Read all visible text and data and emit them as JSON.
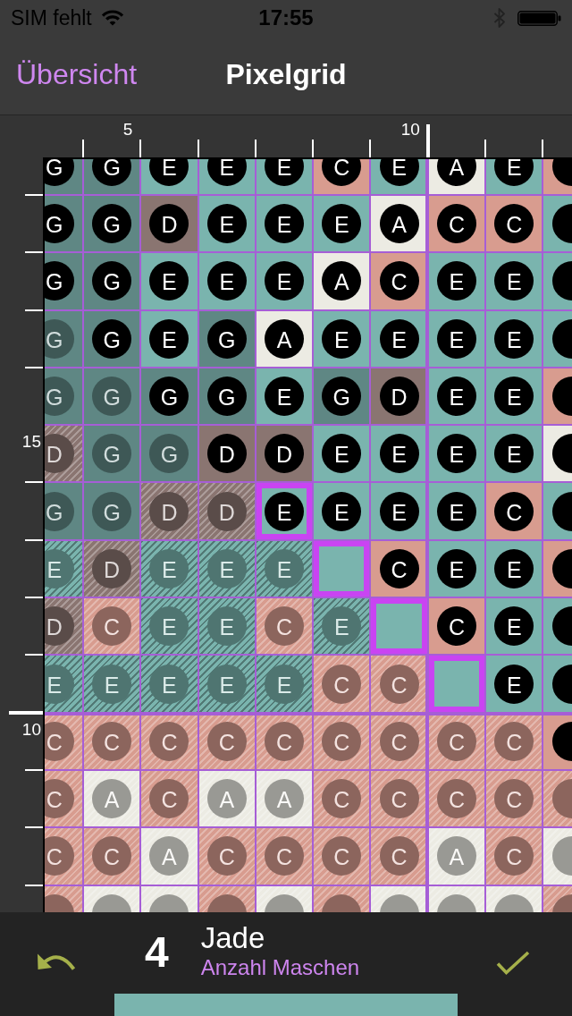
{
  "status_bar": {
    "carrier": "SIM fehlt",
    "time": "17:55"
  },
  "nav_bar": {
    "back": "Übersicht",
    "title": "Pixelgrid"
  },
  "grid": {
    "columns": [
      {
        "major": false
      },
      {
        "major": false,
        "label": "5"
      },
      {
        "major": false
      },
      {
        "major": false
      },
      {
        "major": false
      },
      {
        "major": false
      },
      {
        "major": true,
        "label": "10"
      },
      {
        "major": false
      },
      {
        "major": false
      },
      {
        "major": false
      }
    ],
    "rows": [
      {
        "major": false,
        "cells": [
          {
            "letter": "G",
            "color": "#5f8784",
            "kind": "stitch",
            "selected": false
          },
          {
            "letter": "G",
            "color": "#5f8784",
            "kind": "stitch",
            "selected": false
          },
          {
            "letter": "E",
            "color": "#7ab4ae",
            "kind": "stitch",
            "selected": false
          },
          {
            "letter": "E",
            "color": "#7ab4ae",
            "kind": "stitch",
            "selected": false
          },
          {
            "letter": "E",
            "color": "#7ab4ae",
            "kind": "stitch",
            "selected": false
          },
          {
            "letter": "C",
            "color": "#d89c8f",
            "kind": "stitch",
            "selected": false
          },
          {
            "letter": "E",
            "color": "#7ab4ae",
            "kind": "stitch",
            "selected": false
          },
          {
            "letter": "A",
            "color": "#ecebe3",
            "kind": "stitch",
            "selected": false
          },
          {
            "letter": "E",
            "color": "#7ab4ae",
            "kind": "stitch",
            "selected": false
          },
          {
            "color": "#d89c8f",
            "kind": "stitch",
            "selected": false
          }
        ]
      },
      {
        "major": false,
        "cells": [
          {
            "letter": "G",
            "color": "#5f8784",
            "kind": "stitch",
            "selected": false
          },
          {
            "letter": "G",
            "color": "#5f8784",
            "kind": "stitch",
            "selected": false
          },
          {
            "letter": "D",
            "color": "#8a7571",
            "kind": "stitch",
            "selected": false
          },
          {
            "letter": "E",
            "color": "#7ab4ae",
            "kind": "stitch",
            "selected": false
          },
          {
            "letter": "E",
            "color": "#7ab4ae",
            "kind": "stitch",
            "selected": false
          },
          {
            "letter": "E",
            "color": "#7ab4ae",
            "kind": "stitch",
            "selected": false
          },
          {
            "letter": "A",
            "color": "#ecebe3",
            "kind": "stitch",
            "selected": false
          },
          {
            "letter": "C",
            "color": "#d89c8f",
            "kind": "stitch",
            "selected": false
          },
          {
            "letter": "C",
            "color": "#d89c8f",
            "kind": "stitch",
            "selected": false
          },
          {
            "color": "#7ab4ae",
            "kind": "stitch",
            "selected": false
          }
        ]
      },
      {
        "major": false,
        "cells": [
          {
            "letter": "G",
            "color": "#5f8784",
            "kind": "stitch",
            "selected": false
          },
          {
            "letter": "G",
            "color": "#5f8784",
            "kind": "stitch",
            "selected": false
          },
          {
            "letter": "E",
            "color": "#7ab4ae",
            "kind": "stitch",
            "selected": false
          },
          {
            "letter": "E",
            "color": "#7ab4ae",
            "kind": "stitch",
            "selected": false
          },
          {
            "letter": "E",
            "color": "#7ab4ae",
            "kind": "stitch",
            "selected": false
          },
          {
            "letter": "A",
            "color": "#ecebe3",
            "kind": "stitch",
            "selected": false
          },
          {
            "letter": "C",
            "color": "#d89c8f",
            "kind": "stitch",
            "selected": false
          },
          {
            "letter": "E",
            "color": "#7ab4ae",
            "kind": "stitch",
            "selected": false
          },
          {
            "letter": "E",
            "color": "#7ab4ae",
            "kind": "stitch",
            "selected": false
          },
          {
            "color": "#7ab4ae",
            "kind": "stitch",
            "selected": false
          }
        ]
      },
      {
        "major": false,
        "cells": [
          {
            "letter": "G",
            "color": "#5f8784",
            "kind": "faded",
            "selected": false
          },
          {
            "letter": "G",
            "color": "#5f8784",
            "kind": "stitch",
            "selected": false
          },
          {
            "letter": "E",
            "color": "#7ab4ae",
            "kind": "stitch",
            "selected": false
          },
          {
            "letter": "G",
            "color": "#5f8784",
            "kind": "stitch",
            "selected": false
          },
          {
            "letter": "A",
            "color": "#ecebe3",
            "kind": "stitch",
            "selected": false
          },
          {
            "letter": "E",
            "color": "#7ab4ae",
            "kind": "stitch",
            "selected": false
          },
          {
            "letter": "E",
            "color": "#7ab4ae",
            "kind": "stitch",
            "selected": false
          },
          {
            "letter": "E",
            "color": "#7ab4ae",
            "kind": "stitch",
            "selected": false
          },
          {
            "letter": "E",
            "color": "#7ab4ae",
            "kind": "stitch",
            "selected": false
          },
          {
            "color": "#7ab4ae",
            "kind": "stitch",
            "selected": false
          }
        ]
      },
      {
        "major": false,
        "cells": [
          {
            "letter": "G",
            "color": "#5f8784",
            "kind": "faded",
            "selected": false
          },
          {
            "letter": "G",
            "color": "#5f8784",
            "kind": "faded",
            "selected": false
          },
          {
            "letter": "G",
            "color": "#5f8784",
            "kind": "stitch",
            "selected": false
          },
          {
            "letter": "G",
            "color": "#5f8784",
            "kind": "stitch",
            "selected": false
          },
          {
            "letter": "E",
            "color": "#7ab4ae",
            "kind": "stitch",
            "selected": false
          },
          {
            "letter": "G",
            "color": "#5f8784",
            "kind": "stitch",
            "selected": false
          },
          {
            "letter": "D",
            "color": "#8a7571",
            "kind": "stitch",
            "selected": false
          },
          {
            "letter": "E",
            "color": "#7ab4ae",
            "kind": "stitch",
            "selected": false
          },
          {
            "letter": "E",
            "color": "#7ab4ae",
            "kind": "stitch",
            "selected": false
          },
          {
            "color": "#d89c8f",
            "kind": "stitch",
            "selected": false
          }
        ]
      },
      {
        "major": false,
        "label": "15",
        "cells": [
          {
            "letter": "D",
            "color": "#8a7571",
            "kind": "done",
            "selected": false
          },
          {
            "letter": "G",
            "color": "#5f8784",
            "kind": "faded",
            "selected": false
          },
          {
            "letter": "G",
            "color": "#5f8784",
            "kind": "faded",
            "selected": false
          },
          {
            "letter": "D",
            "color": "#8a7571",
            "kind": "stitch",
            "selected": false
          },
          {
            "letter": "D",
            "color": "#8a7571",
            "kind": "stitch",
            "selected": false
          },
          {
            "letter": "E",
            "color": "#7ab4ae",
            "kind": "stitch",
            "selected": false
          },
          {
            "letter": "E",
            "color": "#7ab4ae",
            "kind": "stitch",
            "selected": false
          },
          {
            "letter": "E",
            "color": "#7ab4ae",
            "kind": "stitch",
            "selected": false
          },
          {
            "letter": "E",
            "color": "#7ab4ae",
            "kind": "stitch",
            "selected": false
          },
          {
            "color": "#ecebe3",
            "kind": "stitch",
            "selected": false
          }
        ]
      },
      {
        "major": false,
        "cells": [
          {
            "letter": "G",
            "color": "#5f8784",
            "kind": "faded",
            "selected": false
          },
          {
            "letter": "G",
            "color": "#5f8784",
            "kind": "faded",
            "selected": false
          },
          {
            "letter": "D",
            "color": "#8a7571",
            "kind": "done",
            "selected": false
          },
          {
            "letter": "D",
            "color": "#8a7571",
            "kind": "done",
            "selected": false
          },
          {
            "letter": "E",
            "color": "#7ab4ae",
            "kind": "stitch",
            "selected": true
          },
          {
            "letter": "E",
            "color": "#7ab4ae",
            "kind": "stitch",
            "selected": false
          },
          {
            "letter": "E",
            "color": "#7ab4ae",
            "kind": "stitch",
            "selected": false
          },
          {
            "letter": "E",
            "color": "#7ab4ae",
            "kind": "stitch",
            "selected": false
          },
          {
            "letter": "C",
            "color": "#d89c8f",
            "kind": "stitch",
            "selected": false
          },
          {
            "color": "#7ab4ae",
            "kind": "stitch",
            "selected": false
          }
        ]
      },
      {
        "major": false,
        "cells": [
          {
            "letter": "E",
            "color": "#7ab4ae",
            "kind": "done",
            "selected": false
          },
          {
            "letter": "D",
            "color": "#8a7571",
            "kind": "done",
            "selected": false
          },
          {
            "letter": "E",
            "color": "#7ab4ae",
            "kind": "done",
            "selected": false
          },
          {
            "letter": "E",
            "color": "#7ab4ae",
            "kind": "done",
            "selected": false
          },
          {
            "letter": "E",
            "color": "#7ab4ae",
            "kind": "done",
            "selected": false
          },
          {
            "color": "#7ab4ae",
            "kind": "blank",
            "selected": true
          },
          {
            "letter": "C",
            "color": "#d89c8f",
            "kind": "stitch",
            "selected": false
          },
          {
            "letter": "E",
            "color": "#7ab4ae",
            "kind": "stitch",
            "selected": false
          },
          {
            "letter": "E",
            "color": "#7ab4ae",
            "kind": "stitch",
            "selected": false
          },
          {
            "color": "#d89c8f",
            "kind": "stitch",
            "selected": false
          }
        ]
      },
      {
        "major": false,
        "cells": [
          {
            "letter": "D",
            "color": "#8a7571",
            "kind": "done",
            "selected": false
          },
          {
            "letter": "C",
            "color": "#d89c8f",
            "kind": "done",
            "selected": false
          },
          {
            "letter": "E",
            "color": "#7ab4ae",
            "kind": "done",
            "selected": false
          },
          {
            "letter": "E",
            "color": "#7ab4ae",
            "kind": "done",
            "selected": false
          },
          {
            "letter": "C",
            "color": "#d89c8f",
            "kind": "done",
            "selected": false
          },
          {
            "letter": "E",
            "color": "#7ab4ae",
            "kind": "done",
            "selected": false
          },
          {
            "color": "#7ab4ae",
            "kind": "blank",
            "selected": true
          },
          {
            "letter": "C",
            "color": "#d89c8f",
            "kind": "stitch",
            "selected": false
          },
          {
            "letter": "E",
            "color": "#7ab4ae",
            "kind": "stitch",
            "selected": false
          },
          {
            "color": "#7ab4ae",
            "kind": "stitch",
            "selected": false
          }
        ]
      },
      {
        "major": false,
        "cells": [
          {
            "letter": "E",
            "color": "#7ab4ae",
            "kind": "done",
            "selected": false
          },
          {
            "letter": "E",
            "color": "#7ab4ae",
            "kind": "done",
            "selected": false
          },
          {
            "letter": "E",
            "color": "#7ab4ae",
            "kind": "done",
            "selected": false
          },
          {
            "letter": "E",
            "color": "#7ab4ae",
            "kind": "done",
            "selected": false
          },
          {
            "letter": "E",
            "color": "#7ab4ae",
            "kind": "done",
            "selected": false
          },
          {
            "letter": "C",
            "color": "#d89c8f",
            "kind": "done",
            "selected": false
          },
          {
            "letter": "C",
            "color": "#d89c8f",
            "kind": "done",
            "selected": false
          },
          {
            "color": "#7ab4ae",
            "kind": "blank",
            "selected": true
          },
          {
            "letter": "E",
            "color": "#7ab4ae",
            "kind": "stitch",
            "selected": false
          },
          {
            "color": "#7ab4ae",
            "kind": "stitch",
            "selected": false
          }
        ]
      },
      {
        "major": true,
        "label": "10",
        "cells": [
          {
            "letter": "C",
            "color": "#d89c8f",
            "kind": "done",
            "selected": false
          },
          {
            "letter": "C",
            "color": "#d89c8f",
            "kind": "done",
            "selected": false
          },
          {
            "letter": "C",
            "color": "#d89c8f",
            "kind": "done",
            "selected": false
          },
          {
            "letter": "C",
            "color": "#d89c8f",
            "kind": "done",
            "selected": false
          },
          {
            "letter": "C",
            "color": "#d89c8f",
            "kind": "done",
            "selected": false
          },
          {
            "letter": "C",
            "color": "#d89c8f",
            "kind": "done",
            "selected": false
          },
          {
            "letter": "C",
            "color": "#d89c8f",
            "kind": "done",
            "selected": false
          },
          {
            "letter": "C",
            "color": "#d89c8f",
            "kind": "done",
            "selected": false
          },
          {
            "letter": "C",
            "color": "#d89c8f",
            "kind": "done",
            "selected": false
          },
          {
            "color": "#d89c8f",
            "kind": "stitch",
            "selected": false
          }
        ]
      },
      {
        "major": false,
        "cells": [
          {
            "letter": "C",
            "color": "#d89c8f",
            "kind": "done",
            "selected": false
          },
          {
            "letter": "A",
            "color": "#ecebe3",
            "kind": "done",
            "selected": false
          },
          {
            "letter": "C",
            "color": "#d89c8f",
            "kind": "done",
            "selected": false
          },
          {
            "letter": "A",
            "color": "#ecebe3",
            "kind": "done",
            "selected": false
          },
          {
            "letter": "A",
            "color": "#ecebe3",
            "kind": "done",
            "selected": false
          },
          {
            "letter": "C",
            "color": "#d89c8f",
            "kind": "done",
            "selected": false
          },
          {
            "letter": "C",
            "color": "#d89c8f",
            "kind": "done",
            "selected": false
          },
          {
            "letter": "C",
            "color": "#d89c8f",
            "kind": "done",
            "selected": false
          },
          {
            "letter": "C",
            "color": "#d89c8f",
            "kind": "done",
            "selected": false
          },
          {
            "color": "#d89c8f",
            "kind": "done",
            "selected": false
          }
        ]
      },
      {
        "major": false,
        "cells": [
          {
            "letter": "C",
            "color": "#d89c8f",
            "kind": "done",
            "selected": false
          },
          {
            "letter": "C",
            "color": "#d89c8f",
            "kind": "done",
            "selected": false
          },
          {
            "letter": "A",
            "color": "#ecebe3",
            "kind": "done",
            "selected": false
          },
          {
            "letter": "C",
            "color": "#d89c8f",
            "kind": "done",
            "selected": false
          },
          {
            "letter": "C",
            "color": "#d89c8f",
            "kind": "done",
            "selected": false
          },
          {
            "letter": "C",
            "color": "#d89c8f",
            "kind": "done",
            "selected": false
          },
          {
            "letter": "C",
            "color": "#d89c8f",
            "kind": "done",
            "selected": false
          },
          {
            "letter": "A",
            "color": "#ecebe3",
            "kind": "done",
            "selected": false
          },
          {
            "letter": "C",
            "color": "#d89c8f",
            "kind": "done",
            "selected": false
          },
          {
            "color": "#ecebe3",
            "kind": "done",
            "selected": false
          }
        ]
      },
      {
        "major": false,
        "cells": [
          {
            "color": "#d89c8f",
            "kind": "done",
            "selected": false
          },
          {
            "color": "#ecebe3",
            "kind": "done",
            "selected": false
          },
          {
            "color": "#ecebe3",
            "kind": "done",
            "selected": false
          },
          {
            "color": "#d89c8f",
            "kind": "done",
            "selected": false
          },
          {
            "color": "#ecebe3",
            "kind": "done",
            "selected": false
          },
          {
            "color": "#d89c8f",
            "kind": "done",
            "selected": false
          },
          {
            "color": "#ecebe3",
            "kind": "done",
            "selected": false
          },
          {
            "color": "#ecebe3",
            "kind": "done",
            "selected": false
          },
          {
            "color": "#ecebe3",
            "kind": "done",
            "selected": false
          },
          {
            "color": "#d89c8f",
            "kind": "done",
            "selected": false
          }
        ]
      }
    ]
  },
  "current_yarn": {
    "count": "4",
    "name": "Jade",
    "caption": "Anzahl Maschen",
    "color": "#7ab4ae"
  }
}
